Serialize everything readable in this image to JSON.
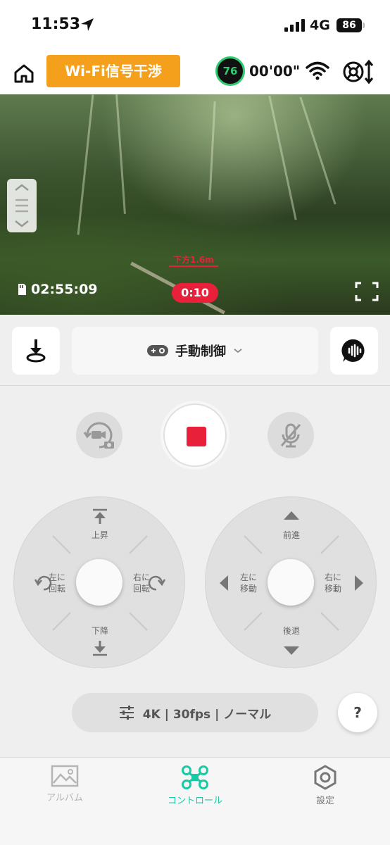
{
  "status_bar": {
    "time": "11:53",
    "network": "4G",
    "battery": "86"
  },
  "header": {
    "wifi_warning": "Wi-Fi信号干渉",
    "drone_battery": "76",
    "flight_time": "00'00\""
  },
  "camera": {
    "record_timer": "02:55:09",
    "recording_elapsed": "0:10",
    "distance_tag": "下方1.6m"
  },
  "mode": {
    "label": "手動制御"
  },
  "left_stick": {
    "up": "上昇",
    "down": "下降",
    "left": "左に\n回転",
    "right": "右に\n回転"
  },
  "right_stick": {
    "up": "前進",
    "down": "後退",
    "left": "左に\n移動",
    "right": "右に\n移動"
  },
  "video_settings": {
    "label": "4K | 30fps | ノーマル"
  },
  "help": {
    "label": "?"
  },
  "tabs": [
    {
      "label": "アルバム",
      "icon": "image-icon",
      "state": "inactive"
    },
    {
      "label": "コントロール",
      "icon": "drone-icon",
      "state": "active"
    },
    {
      "label": "設定",
      "icon": "hexagon-gear-icon",
      "state": "inactive"
    }
  ],
  "colors": {
    "accent": "#18c9a4",
    "warning": "#f4a01d",
    "record": "#e8203a",
    "battery_ok": "#2ecc71"
  }
}
